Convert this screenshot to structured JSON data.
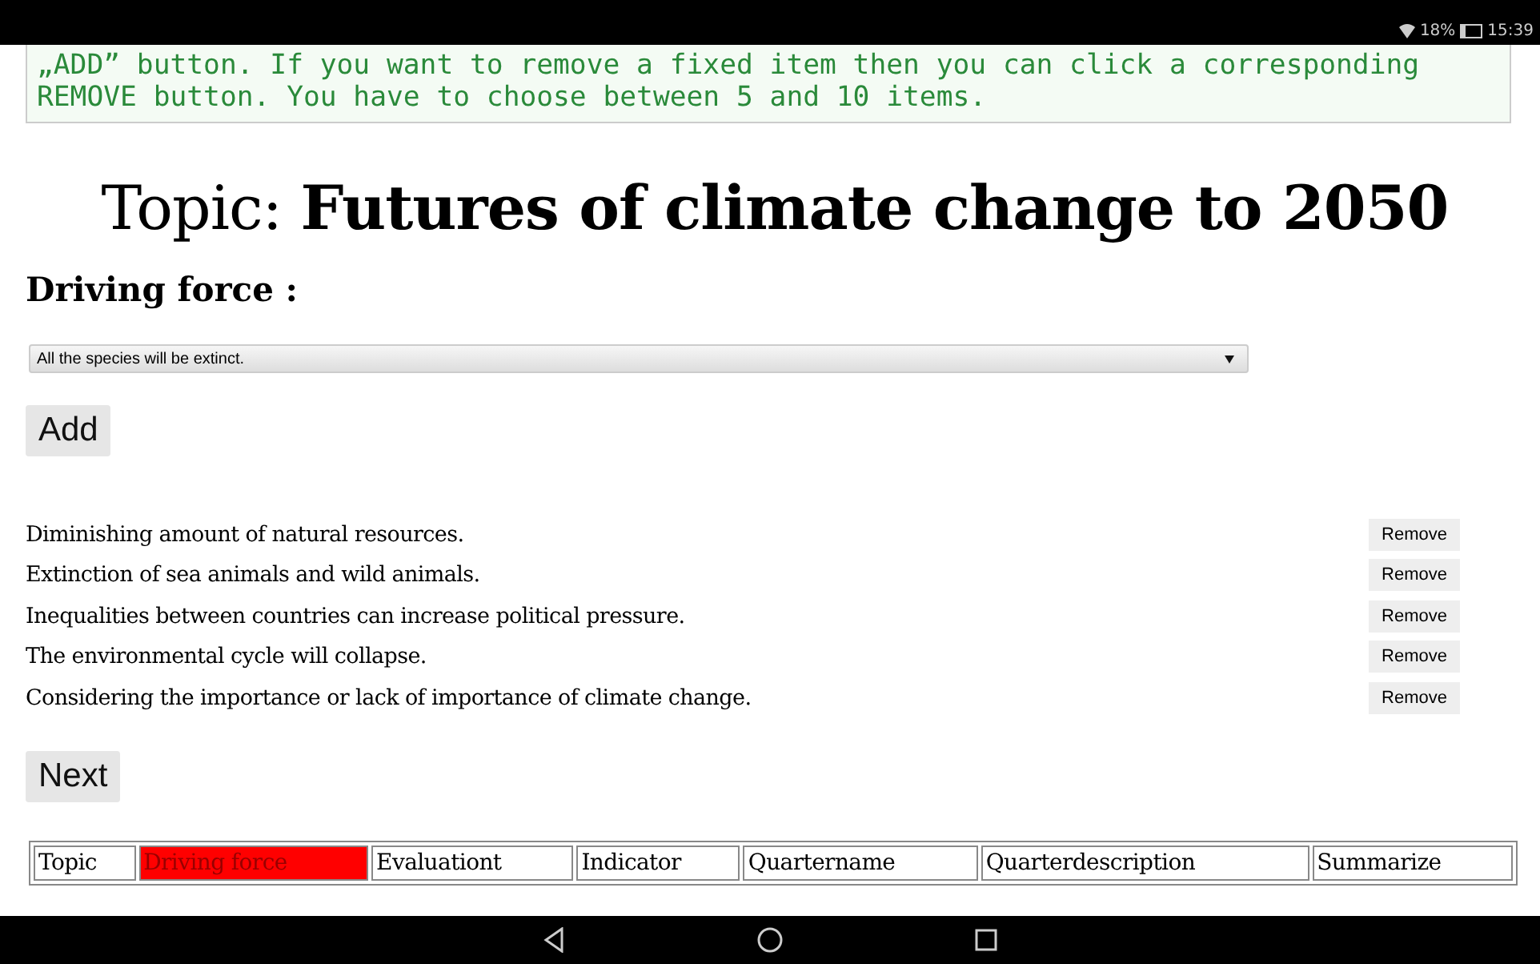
{
  "status_bar": {
    "battery": "18%",
    "time": "15:39"
  },
  "instructions": "„ADD” button. If you want to remove a fixed item then you can click a corresponding REMOVE button. You have to choose between 5 and 10 items.",
  "title": "Topic: **Futures of climate change to 2050**",
  "section_label": "Driving force :",
  "dropdown": {
    "value": "All the species will be extinct."
  },
  "add_button": "Add",
  "items": [
    {
      "text": "Diminishing amount of natural resources.",
      "button": "Remove"
    },
    {
      "text": "Extinction of sea animals and wild animals.",
      "button": "Remove"
    },
    {
      "text": "Inequalities between countries can increase political pressure.",
      "button": "Remove"
    },
    {
      "text": "The environmental cycle will collapse.",
      "button": "Remove"
    },
    {
      "text": "Considering the importance or lack of importance of climate change.",
      "button": "Remove"
    }
  ],
  "next_button": "Next",
  "steps": [
    {
      "label": "Topic",
      "selected": false
    },
    {
      "label": "Driving force",
      "selected": true
    },
    {
      "label": "Evaluationt",
      "selected": false
    },
    {
      "label": "Indicator",
      "selected": false
    },
    {
      "label": "Quartername",
      "selected": false
    },
    {
      "label": "Quarterdescription",
      "selected": false
    },
    {
      "label": "Summarize",
      "selected": false
    }
  ]
}
